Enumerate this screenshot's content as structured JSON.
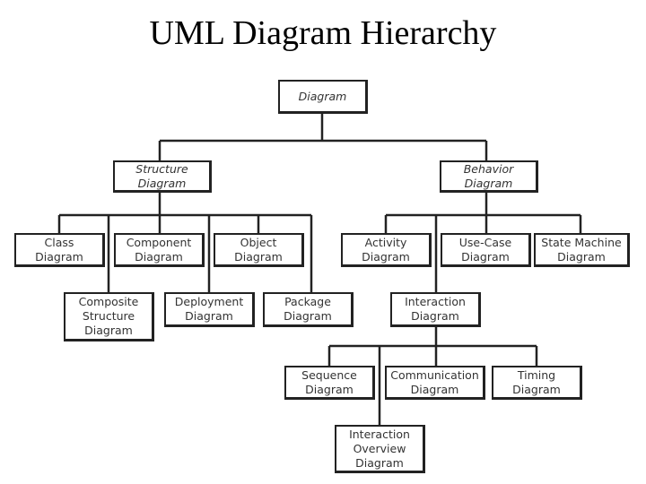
{
  "title": "UML Diagram Hierarchy",
  "nodes": {
    "diagram": {
      "lines": [
        "Diagram"
      ],
      "abstract": true
    },
    "structure": {
      "lines": [
        "Structure",
        "Diagram"
      ],
      "abstract": true
    },
    "behavior": {
      "lines": [
        "Behavior",
        "Diagram"
      ],
      "abstract": true
    },
    "class": {
      "lines": [
        "Class",
        "Diagram"
      ]
    },
    "component": {
      "lines": [
        "Component",
        "Diagram"
      ]
    },
    "object": {
      "lines": [
        "Object",
        "Diagram"
      ]
    },
    "composite": {
      "lines": [
        "Composite",
        "Structure",
        "Diagram"
      ]
    },
    "deployment": {
      "lines": [
        "Deployment",
        "Diagram"
      ]
    },
    "package": {
      "lines": [
        "Package",
        "Diagram"
      ]
    },
    "activity": {
      "lines": [
        "Activity",
        "Diagram"
      ]
    },
    "usecase": {
      "lines": [
        "Use-Case",
        "Diagram"
      ]
    },
    "statemachine": {
      "lines": [
        "State Machine",
        "Diagram"
      ]
    },
    "interaction": {
      "lines": [
        "Interaction",
        "Diagram"
      ],
      "abstract": true
    },
    "sequence": {
      "lines": [
        "Sequence",
        "Diagram"
      ]
    },
    "communication": {
      "lines": [
        "Communication",
        "Diagram"
      ]
    },
    "timing": {
      "lines": [
        "Timing",
        "Diagram"
      ]
    },
    "interactionoverview": {
      "lines": [
        "Interaction",
        "Overview",
        "Diagram"
      ]
    }
  },
  "hierarchy": {
    "diagram": [
      "structure",
      "behavior"
    ],
    "structure": [
      "class",
      "component",
      "object",
      "composite",
      "deployment",
      "package"
    ],
    "behavior": [
      "activity",
      "usecase",
      "statemachine",
      "interaction"
    ],
    "interaction": [
      "sequence",
      "communication",
      "timing",
      "interactionoverview"
    ]
  }
}
